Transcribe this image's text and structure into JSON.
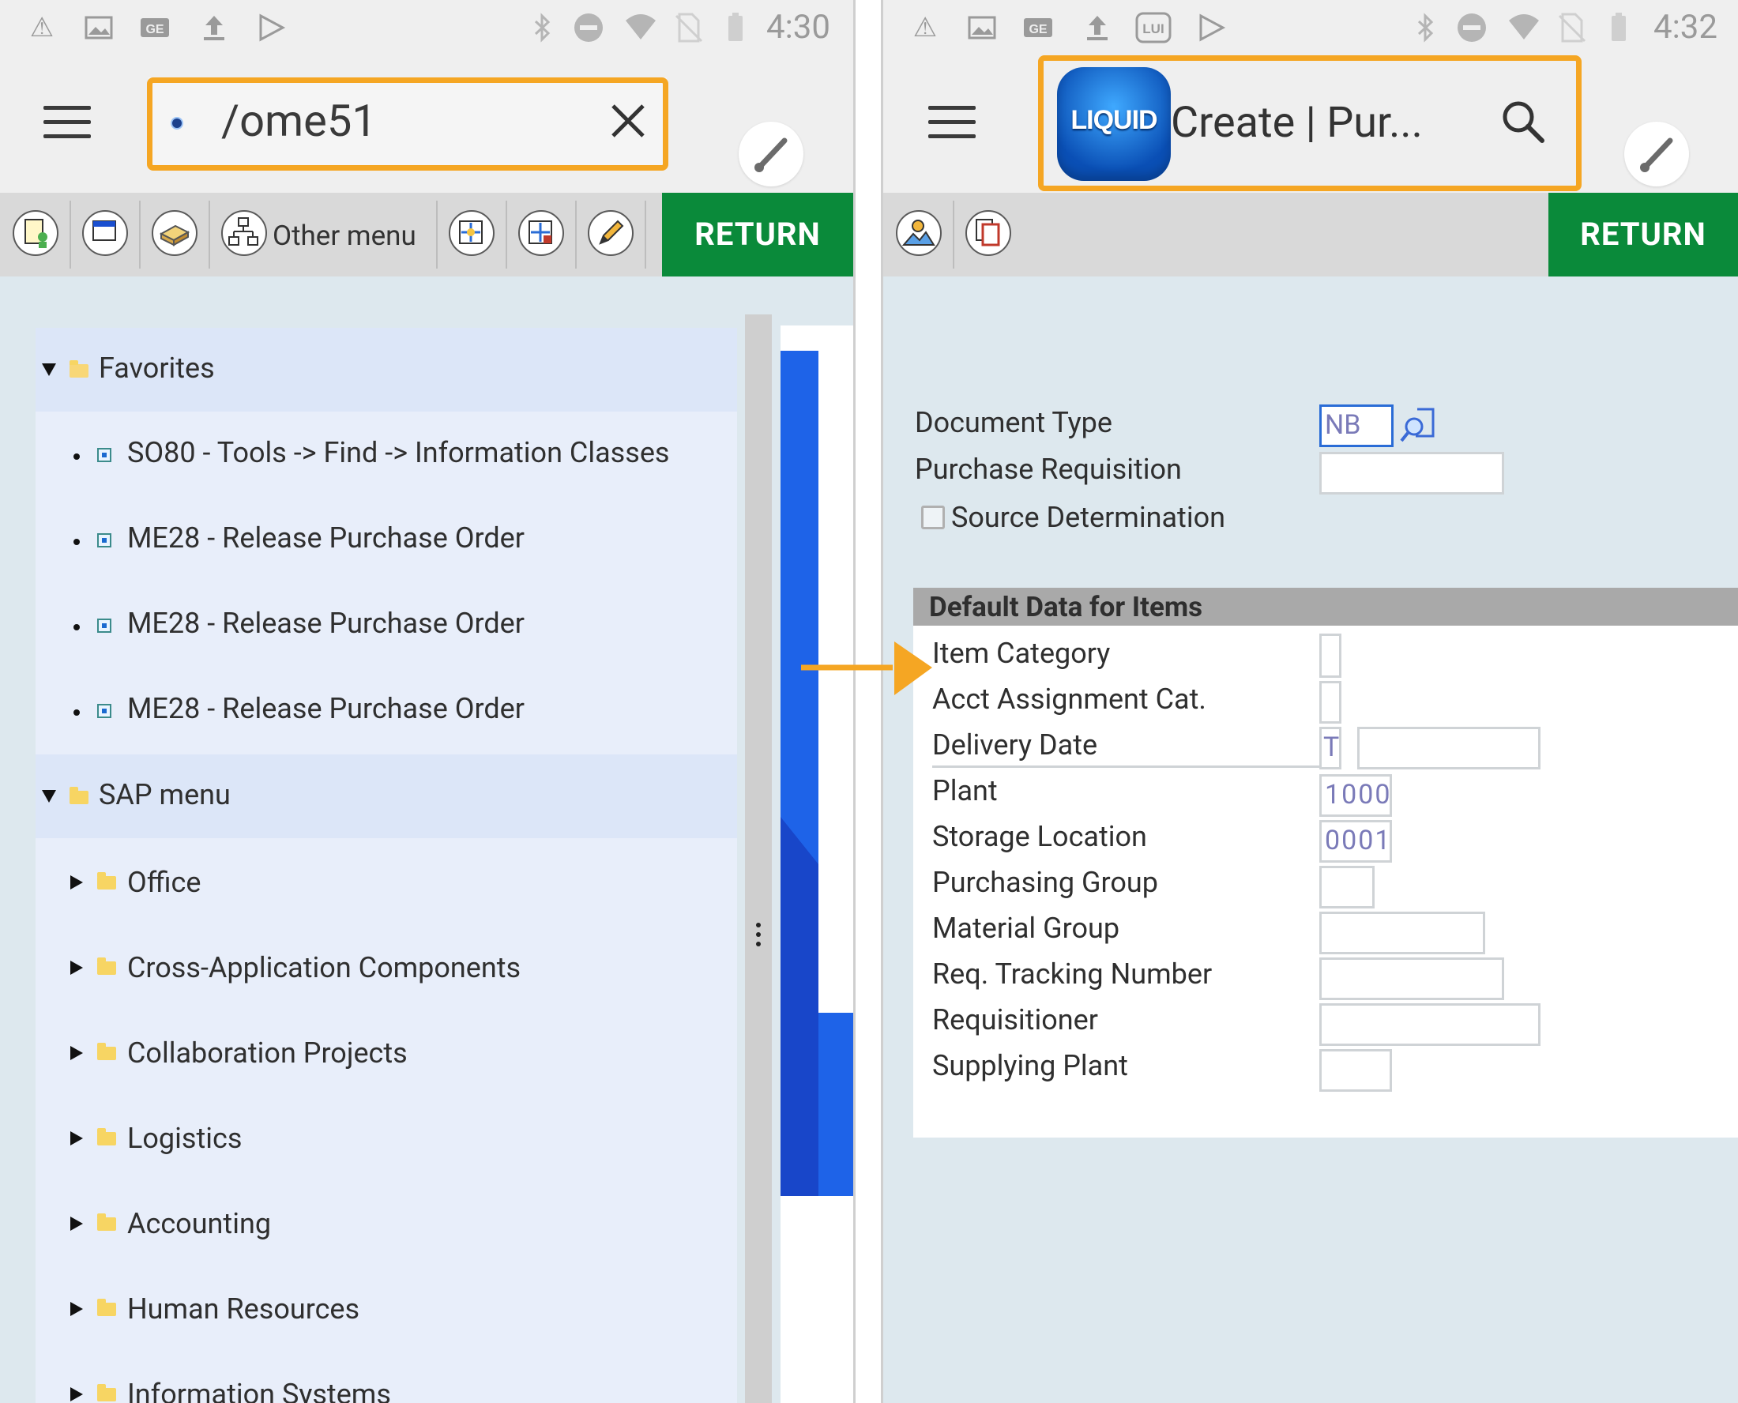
{
  "left_screen": {
    "status": {
      "time": "4:30"
    },
    "search": {
      "value": "/ome51"
    },
    "toolbar": {
      "other_menu_label": "Other menu",
      "return_label": "RETURN"
    },
    "tree": {
      "favorites_label": "Favorites",
      "favorites_items": [
        "SO80 - Tools -> Find -> Information Classes",
        "ME28 - Release Purchase Order",
        "ME28 - Release Purchase Order",
        "ME28 - Release Purchase Order"
      ],
      "sap_menu_label": "SAP menu",
      "sap_menu_items": [
        "Office",
        "Cross-Application Components",
        "Collaboration Projects",
        "Logistics",
        "Accounting",
        "Human Resources",
        "Information Systems"
      ]
    }
  },
  "right_screen": {
    "status": {
      "time": "4:32"
    },
    "title": {
      "logo_text": "LIQUID",
      "text": "Create |  Pur..."
    },
    "toolbar": {
      "return_label": "RETURN"
    },
    "form": {
      "document_type_label": "Document Type",
      "document_type_value": "NB",
      "purchase_requisition_label": "Purchase Requisition",
      "purchase_requisition_value": "",
      "source_determination_label": "Source Determination",
      "section_header": "Default Data for Items",
      "item_category_label": "Item Category",
      "acct_assignment_label": "Acct Assignment Cat.",
      "delivery_date_label": "Delivery Date",
      "delivery_date_type": "T",
      "plant_label": "Plant",
      "plant_value": "1000",
      "storage_location_label": "Storage Location",
      "storage_location_value": "0001",
      "purchasing_group_label": "Purchasing Group",
      "material_group_label": "Material Group",
      "req_tracking_label": "Req. Tracking Number",
      "requisitioner_label": "Requisitioner",
      "supplying_plant_label": "Supplying Plant"
    }
  },
  "colors": {
    "highlight": "#f5a623",
    "return_green": "#0a8a3a",
    "tree_bg": "#e8eefa"
  }
}
